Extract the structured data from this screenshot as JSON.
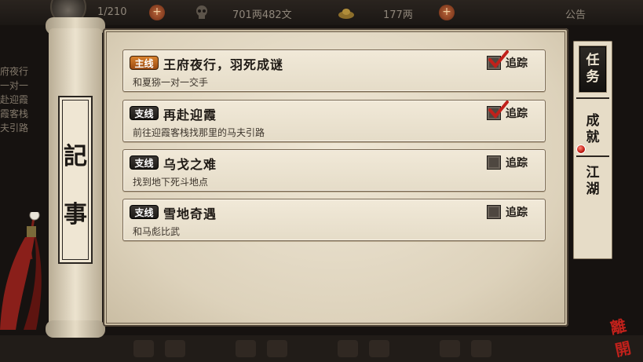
{
  "topbar": {
    "level": "1/210",
    "money": "701两482文",
    "gold": "177两",
    "notice": "公告"
  },
  "background_text": [
    "府夜行",
    "一对一",
    "赴迎霞",
    "霞客栈",
    "夫引路"
  ],
  "scroll": {
    "title_chars": [
      "記",
      "事"
    ]
  },
  "quests": [
    {
      "type": "main",
      "tag": "主线",
      "title": "王府夜行，羽死成谜",
      "desc": "和夏猕一对一交手",
      "tracked": true,
      "track_label": "追踪"
    },
    {
      "type": "side",
      "tag": "支线",
      "title": "再赴迎霞",
      "desc": "前往迎霞客栈找那里的马夫引路",
      "tracked": true,
      "track_label": "追踪"
    },
    {
      "type": "side",
      "tag": "支线",
      "title": "乌戈之难",
      "desc": "找到地下死斗地点",
      "tracked": false,
      "track_label": "追踪"
    },
    {
      "type": "side",
      "tag": "支线",
      "title": "雪地奇遇",
      "desc": "和马彪比武",
      "tracked": false,
      "track_label": "追踪"
    }
  ],
  "tabs": {
    "tasks": "任务",
    "achievements": "成就",
    "jianghu": "江湖"
  },
  "leave_label": "離開",
  "colors": {
    "accent_red": "#c0211b",
    "main_tag": "#d9822e",
    "side_tag": "#2a2623",
    "paper": "#efe7d6"
  },
  "icons": [
    "avatar-icon",
    "plus-icon",
    "skull-icon",
    "ingot-icon",
    "checkmark-icon",
    "red-dot-icon"
  ]
}
